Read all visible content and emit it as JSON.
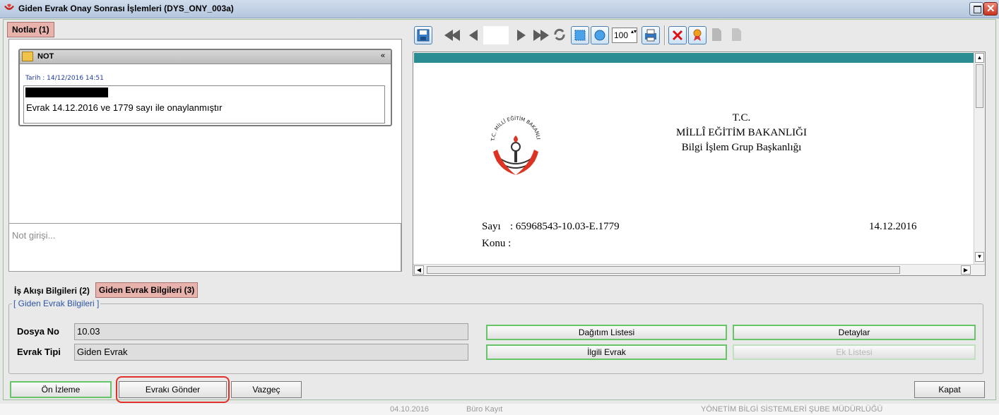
{
  "window": {
    "title": "Giden Evrak Onay Sonrası İşlemleri (DYS_ONY_003a)"
  },
  "notes": {
    "tab_label": "Notlar (1)",
    "card_title": "NOT",
    "date_text": "Tarih : 14/12/2016 14:51",
    "note_text": "Evrak 14.12.2016 ve 1779 sayı ile onaylanmıştır",
    "input_placeholder": "Not girişi..."
  },
  "toolbar": {
    "zoom_value": "100",
    "icons": [
      "save-icon",
      "first-page-icon",
      "prev-page-icon",
      "next-page-icon",
      "last-page-icon",
      "refresh-icon",
      "fit-page-icon",
      "fit-width-icon",
      "print-icon",
      "cancel-icon",
      "award-icon",
      "doc-gray-icon",
      "doc-gray-icon-2"
    ]
  },
  "document": {
    "header_line1": "T.C.",
    "header_line2": "MİLLÎ EĞİTİM BAKANLIĞI",
    "header_line3": "Bilgi İşlem Grup Başkanlığı",
    "sayi_label": "Sayı",
    "sayi_value": ": 65968543-10.03-E.1779",
    "date": "14.12.2016",
    "konu_label": "Konu :",
    "emblem_text": "T.C. MİLLÎ EĞİTİM BAKANLIĞI"
  },
  "info_tabs": [
    {
      "label": "İş Akışı Bilgileri (2)",
      "active": false
    },
    {
      "label": "Giden Evrak Bilgileri (3)",
      "active": true
    }
  ],
  "group": {
    "legend": "[ Giden Evrak Bilgileri ]",
    "dosya_no_label": "Dosya No",
    "dosya_no_value": "10.03",
    "evrak_tipi_label": "Evrak Tipi",
    "evrak_tipi_value": "Giden Evrak"
  },
  "buttons": {
    "dagitim_listesi": "Dağıtım Listesi",
    "detaylar": "Detaylar",
    "ilgili_evrak": "İlgili Evrak",
    "ek_listesi": "Ek Listesi",
    "on_izleme": "Ön İzleme",
    "evraki_gonder": "Evrakı Gönder",
    "vazgec": "Vazgeç",
    "kapat": "Kapat"
  },
  "background_strip": {
    "date": "04.10.2016",
    "type": "Büro Kayıt",
    "unit": "YÖNETİM BİLGİ SİSTEMLERİ ŞUBE MÜDÜRLÜĞÜ"
  },
  "colors": {
    "active_tab": "#e8b3ad",
    "button_border": "#68c468",
    "highlight_circle": "#e0302a",
    "teal_bar": "#2a8d94"
  }
}
